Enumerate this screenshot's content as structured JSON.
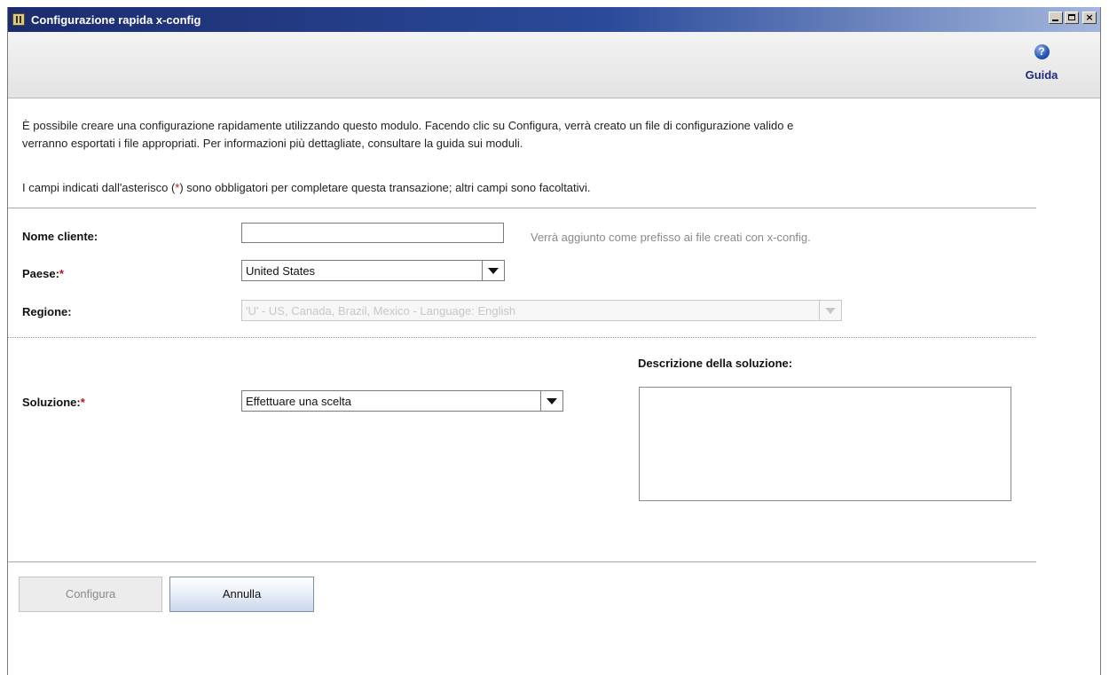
{
  "window": {
    "title": "Configurazione rapida x-config",
    "controls": {
      "minimize": "_",
      "maximize": "□",
      "close": "×"
    }
  },
  "toolbar": {
    "help_icon": "help-question-icon",
    "help_label": "Guida"
  },
  "intro": {
    "line1": "È possibile creare una configurazione rapidamente utilizzando questo modulo. Facendo clic su Configura, verrà creato un file di configurazione valido e",
    "line2": "verranno esportati i file appropriati. Per informazioni più dettagliate, consultare la guida sui moduli.",
    "required_before": "I campi indicati dall'asterisco (",
    "required_star": "*",
    "required_after": ") sono obbligatori per completare questa transazione; altri campi sono facoltativi."
  },
  "form": {
    "customer_name": {
      "label": "Nome cliente:",
      "value": "",
      "hint": "Verrà aggiunto come prefisso ai file creati con x-config."
    },
    "country": {
      "label": "Paese:",
      "required": "*",
      "value": "United States"
    },
    "region": {
      "label": "Regione:",
      "value": "'U' - US, Canada, Brazil, Mexico - Language: English",
      "disabled": true
    },
    "solution": {
      "label": "Soluzione:",
      "required": "*",
      "value": "Effettuare una scelta"
    },
    "solution_description": {
      "label": "Descrizione della soluzione:",
      "value": ""
    }
  },
  "buttons": {
    "configure": {
      "label": "Configura",
      "enabled": false
    },
    "cancel": {
      "label": "Annulla",
      "enabled": true
    }
  },
  "colors": {
    "title_bar_start": "#1b2c6e",
    "title_bar_end": "#a3b7dc",
    "required_star": "#c0101a",
    "help_label": "#1e2a7c",
    "hint_text": "#8a8a8a",
    "disabled_text": "#c4c7cd"
  }
}
